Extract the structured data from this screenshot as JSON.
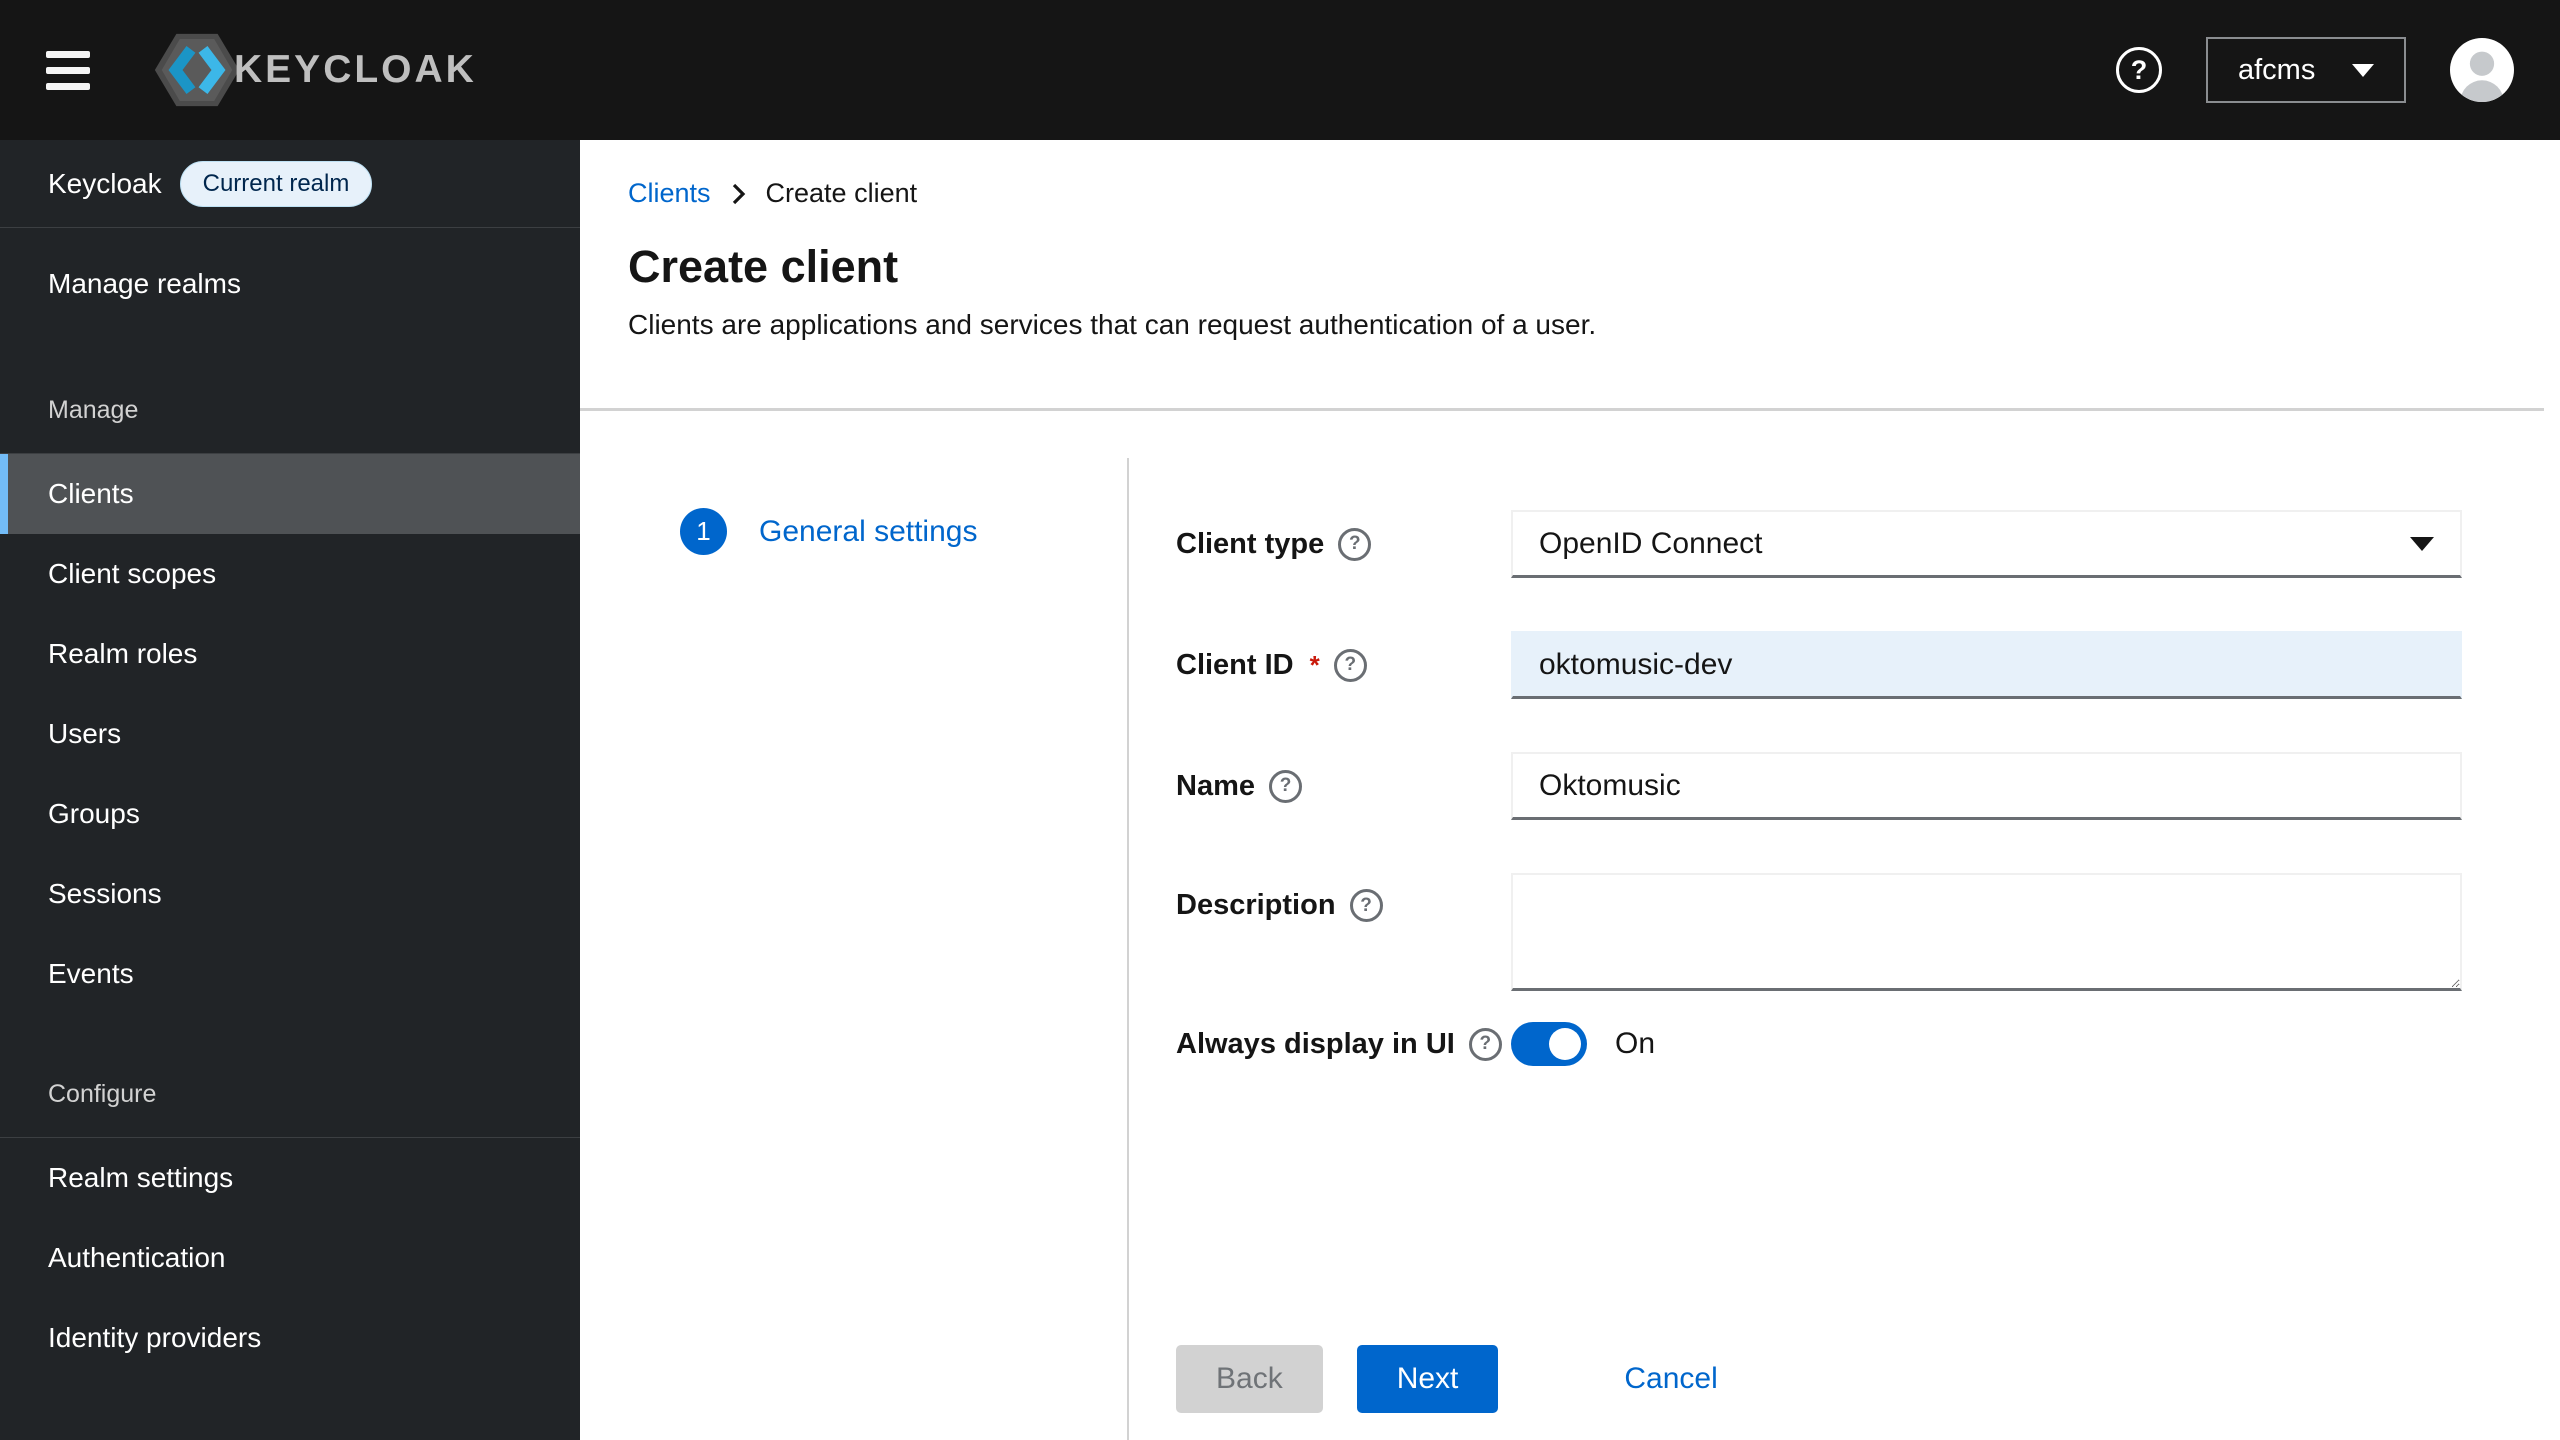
{
  "masthead": {
    "brand": "KEYCLOAK",
    "realm_select": "afcms"
  },
  "icons": {
    "help_glyph": "?",
    "step_number": "1"
  },
  "sidebar": {
    "realm_name": "Keycloak",
    "realm_badge": "Current realm",
    "manage_realms": "Manage realms",
    "section_manage": "Manage",
    "manage_items": [
      "Clients",
      "Client scopes",
      "Realm roles",
      "Users",
      "Groups",
      "Sessions",
      "Events"
    ],
    "selected_item": "Clients",
    "section_configure": "Configure",
    "configure_items": [
      "Realm settings",
      "Authentication",
      "Identity providers"
    ]
  },
  "breadcrumb": {
    "parent": "Clients",
    "current": "Create client"
  },
  "page": {
    "title": "Create client",
    "subtitle": "Clients are applications and services that can request authentication of a user."
  },
  "wizard": {
    "step_label": "General settings"
  },
  "form": {
    "client_type": {
      "label": "Client type",
      "value": "OpenID Connect"
    },
    "client_id": {
      "label": "Client ID",
      "required_marker": "*",
      "value": "oktomusic-dev"
    },
    "name": {
      "label": "Name",
      "value": "Oktomusic"
    },
    "description": {
      "label": "Description",
      "value": ""
    },
    "always_display": {
      "label": "Always display in UI",
      "state": "On"
    },
    "buttons": {
      "back": "Back",
      "next": "Next",
      "cancel": "Cancel"
    }
  },
  "colors": {
    "accent": "#0066cc",
    "masthead_bg": "#151515",
    "sidebar_bg": "#212427",
    "selected_nav_bg": "#4f5255",
    "nav_accent": "#73bcf7",
    "client_id_bg": "#e7f1fa",
    "danger": "#c9190b"
  }
}
